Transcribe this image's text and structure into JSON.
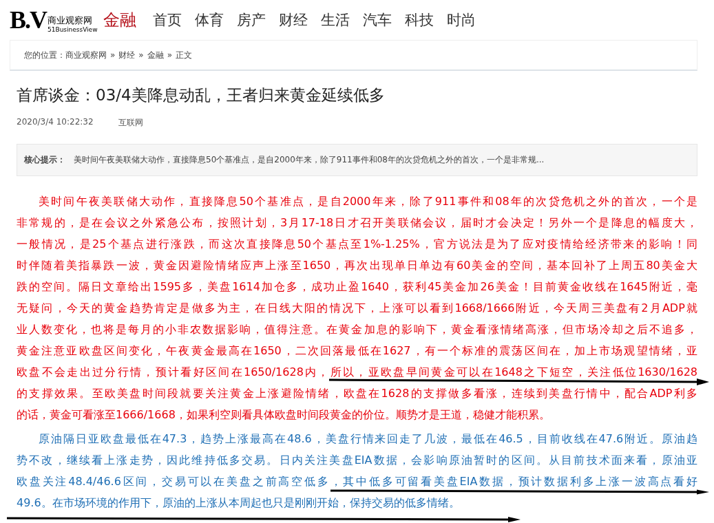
{
  "logo": {
    "mark": "B.V",
    "name": "商业观察网",
    "sub": "51BusinessView"
  },
  "section": "金融",
  "nav": [
    {
      "label": "首页",
      "selected": false
    },
    {
      "label": "体育",
      "selected": false
    },
    {
      "label": "房产",
      "selected": false
    },
    {
      "label": "财经",
      "selected": false
    },
    {
      "label": "生活",
      "selected": false
    },
    {
      "label": "汽车",
      "selected": false
    },
    {
      "label": "科技",
      "selected": false
    },
    {
      "label": "时尚",
      "selected": false
    }
  ],
  "breadcrumb": {
    "prefix": "您的位置：",
    "separator": "»",
    "items": [
      "商业观察网",
      "财经",
      "金融",
      "正文"
    ]
  },
  "article": {
    "title": "首席谈金：03/4美降息动乱，王者归来黄金延续低多",
    "date": "2020/3/4 10:22:32",
    "source": "互联网",
    "summary_label": "核心提示：",
    "summary": "美时间午夜美联储大动作，直接降息50个基准点，是自2000年来，除了911事件和08年的次贷危机之外的首次，一个是非常规...",
    "paragraphs": [
      {
        "color": "#e8000b",
        "lines": [
          "美时间午夜美联储大动作，直接降息50个基准点，是自2000年来，除了911事件和08年的次贷危机之外的首次，一个是",
          "非常规的，是在会议之外紧急公布，按照计划，3月17-18日才召开美联储会议，届时才会决定！另外一个是降息的幅度大，",
          "一般情况，是25个基点进行涨跌，而这次直接降息50个基点至1%-1.25%，官方说法是为了应对疫情给经济带来的影响！同",
          "时伴随着美指暴跌一波，黄金因避险情绪应声上涨至1650，再次出现单日单边有60美金的空间，基本回补了上周五80美金大",
          "跌的空间。隔日文章给出1595多，美盘1614加仓多，成功止盈1640，获利45美金加26美金！目前黄金收线在1645附近，毫",
          "无疑问，今天的黄金趋势肯定是做多为主，在日线大阳的情况下，上涨可以看到1668/1666附近，今天周三美盘有2月ADP就",
          "业人数变化，也将是每月的小非农数据影响，值得注意。在黄金加息的影响下，黄金看涨情绪高涨，但市场冷却之后不追多，",
          "黄金注意亚欧盘区间变化，午夜黄金最高在1650，二次回落最低在1627，有一个标准的震荡区间在，加上市场观望情绪，亚",
          "欧盘不会走出过分行情，预计看好区间在1650/1628内，所以，亚欧盘早间黄金可以在1648之下短空，关注低位1630/1628",
          "的支撑效果。至欧美盘时间段就要关注黄金上涨避险情绪，欧盘在1628的支撑做多看涨，连续到美盘行情中，配合ADP利多",
          "的话，黄金可看涨至1666/1668，如果利空则看具体欧盘时间段黄金的价位。顺势才是王道，稳健才能积累。"
        ]
      },
      {
        "color": "#1f6fb5",
        "lines": [
          "原油隔日亚欧盘最低在47.3，趋势上涨最高在48.6，美盘行情来回走了几波，最低在46.5，目前收线在47.6附近。原油趋",
          "势不改，继续看上涨走势，因此维持低多交易。日内关注美盘EIA数据，会影响原油暂时的区间。从目前技术面来看，原油亚",
          "欧盘关注48.4/46.6区间，交易可以在美盘之前高空低多，其中低多可留看美盘EIA数据，预计数据利多上涨一波高点看好",
          "49.6。在市场环境的作用下，原油的上涨从本周起也只是刚刚开始，保持交易的低多情绪。"
        ]
      }
    ]
  }
}
